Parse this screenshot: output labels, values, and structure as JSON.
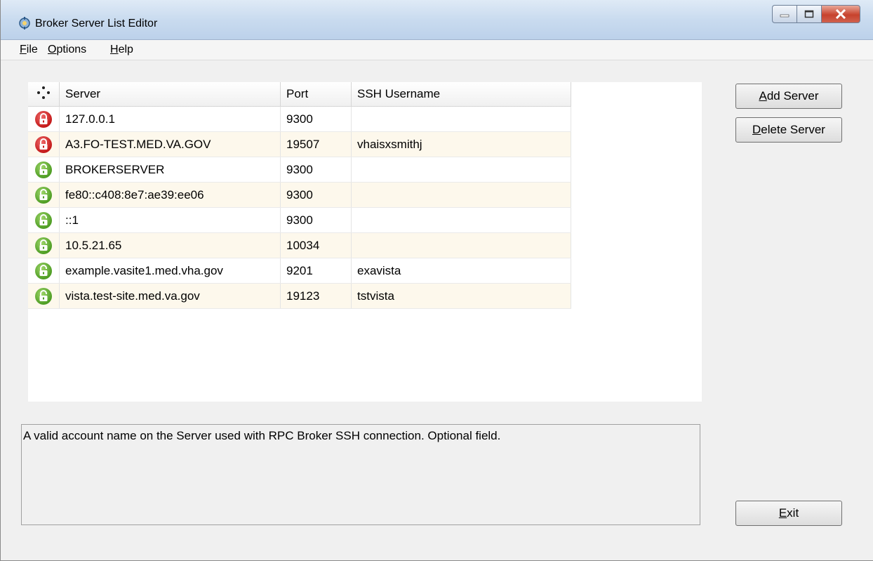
{
  "window": {
    "title": "Broker Server List Editor",
    "icon": "gear-person-icon"
  },
  "menu": [
    {
      "accel": "F",
      "rest": "ile"
    },
    {
      "accel": "O",
      "rest": "ptions"
    },
    {
      "accel": "H",
      "rest": "elp"
    }
  ],
  "table": {
    "columns": [
      "Server",
      "Port",
      "SSH Username"
    ],
    "rows": [
      {
        "status": "locked",
        "server": "127.0.0.1",
        "port": "9300",
        "ssh_username": ""
      },
      {
        "status": "locked",
        "server": "A3.FO-TEST.MED.VA.GOV",
        "port": "19507",
        "ssh_username": "vhaisxsmithj"
      },
      {
        "status": "unlocked",
        "server": "BROKERSERVER",
        "port": "9300",
        "ssh_username": ""
      },
      {
        "status": "unlocked",
        "server": "fe80::c408:8e7:ae39:ee06",
        "port": "9300",
        "ssh_username": ""
      },
      {
        "status": "unlocked",
        "server": "::1",
        "port": "9300",
        "ssh_username": ""
      },
      {
        "status": "unlocked",
        "server": "10.5.21.65",
        "port": "10034",
        "ssh_username": ""
      },
      {
        "status": "unlocked",
        "server": "example.vasite1.med.vha.gov",
        "port": "9201",
        "ssh_username": "exavista"
      },
      {
        "status": "unlocked",
        "server": "vista.test-site.med.va.gov",
        "port": "19123",
        "ssh_username": "tstvista"
      }
    ]
  },
  "description": "A valid account name on the Server used with RPC Broker SSH connection.  Optional field.",
  "buttons": {
    "add_server": {
      "accel": "A",
      "rest": "dd Server"
    },
    "delete_server": {
      "accel": "D",
      "rest": "elete Server"
    },
    "exit": {
      "accel": "E",
      "rest": "xit"
    }
  },
  "colors": {
    "locked": "#c41a1a",
    "unlocked": "#4e9d24",
    "row_alt": "#fdf8ec"
  }
}
